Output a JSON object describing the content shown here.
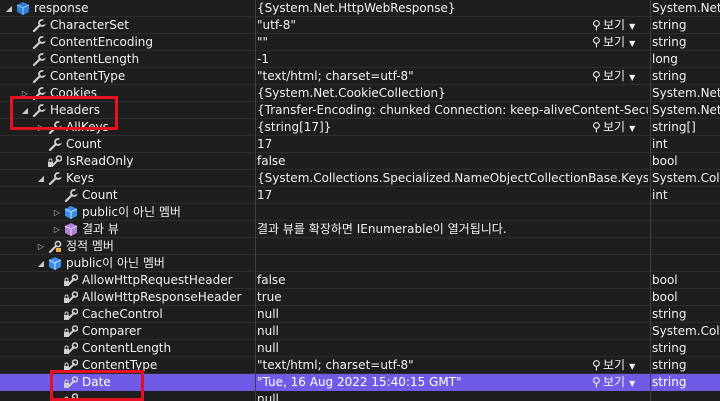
{
  "rows": [
    {
      "expander": "open",
      "icon": "object-icon",
      "name": "response",
      "value": "{System.Net.HttpWebResponse}",
      "type": "System.Net.W",
      "level": 0,
      "viz": false
    },
    {
      "expander": "",
      "icon": "wrench-icon",
      "name": "CharacterSet",
      "value": "\"utf-8\"",
      "type": "string",
      "level": 1,
      "viz": true
    },
    {
      "expander": "",
      "icon": "wrench-icon",
      "name": "ContentEncoding",
      "value": "\"\"",
      "type": "string",
      "level": 1,
      "viz": true
    },
    {
      "expander": "",
      "icon": "wrench-icon",
      "name": "ContentLength",
      "value": "-1",
      "type": "long",
      "level": 1,
      "viz": false
    },
    {
      "expander": "",
      "icon": "wrench-icon",
      "name": "ContentType",
      "value": "\"text/html; charset=utf-8\"",
      "type": "string",
      "level": 1,
      "viz": true
    },
    {
      "expander": "closed",
      "icon": "wrench-icon",
      "name": "Cookies",
      "value": "{System.Net.CookieCollection}",
      "type": "System.Net.C",
      "level": 1,
      "viz": false
    },
    {
      "expander": "open",
      "icon": "wrench-icon",
      "name": "Headers",
      "value": "{Transfer-Encoding: chunked Connection: keep-aliveContent-Security-P...",
      "type": "System.Net.W",
      "level": 1,
      "viz": false
    },
    {
      "expander": "closed",
      "icon": "wrench-icon",
      "name": "AllKeys",
      "value": "{string[17]}",
      "type": "string[]",
      "level": 2,
      "viz": true
    },
    {
      "expander": "",
      "icon": "wrench-icon",
      "name": "Count",
      "value": "17",
      "type": "int",
      "level": 2,
      "viz": false
    },
    {
      "expander": "",
      "icon": "wrench-lock-icon",
      "name": "IsReadOnly",
      "value": "false",
      "type": "bool",
      "level": 2,
      "viz": false
    },
    {
      "expander": "open",
      "icon": "wrench-icon",
      "name": "Keys",
      "value": "{System.Collections.Specialized.NameObjectCollectionBase.KeysCollect...",
      "type": "System.Colle",
      "level": 2,
      "viz": false
    },
    {
      "expander": "",
      "icon": "wrench-icon",
      "name": "Count",
      "value": "17",
      "type": "int",
      "level": 3,
      "viz": false
    },
    {
      "expander": "closed",
      "icon": "cube-blue-icon",
      "name": "public이 아닌 멤버",
      "value": "",
      "type": "",
      "level": 3,
      "viz": false
    },
    {
      "expander": "closed",
      "icon": "cube-purple-icon",
      "name": "결과 뷰",
      "value": "결과 뷰를 확장하면 IEnumerable이 열거됩니다.",
      "type": "",
      "level": 3,
      "viz": false
    },
    {
      "expander": "closed",
      "icon": "static-members-icon",
      "name": "정적 멤버",
      "value": "",
      "type": "",
      "level": 2,
      "viz": false
    },
    {
      "expander": "open",
      "icon": "cube-blue-icon",
      "name": "public이 아닌 멤버",
      "value": "",
      "type": "",
      "level": 2,
      "viz": false
    },
    {
      "expander": "",
      "icon": "wrench-lock-icon",
      "name": "AllowHttpRequestHeader",
      "value": "false",
      "type": "bool",
      "level": 3,
      "viz": false
    },
    {
      "expander": "",
      "icon": "wrench-lock-icon",
      "name": "AllowHttpResponseHeader",
      "value": "true",
      "type": "bool",
      "level": 3,
      "viz": false
    },
    {
      "expander": "",
      "icon": "wrench-lock-icon",
      "name": "CacheControl",
      "value": "null",
      "type": "string",
      "level": 3,
      "viz": false
    },
    {
      "expander": "",
      "icon": "wrench-lock-icon",
      "name": "Comparer",
      "value": "null",
      "type": "System.Colle",
      "level": 3,
      "viz": false
    },
    {
      "expander": "",
      "icon": "wrench-lock-icon",
      "name": "ContentLength",
      "value": "null",
      "type": "string",
      "level": 3,
      "viz": false
    },
    {
      "expander": "",
      "icon": "wrench-lock-icon",
      "name": "ContentType",
      "value": "\"text/html; charset=utf-8\"",
      "type": "string",
      "level": 3,
      "viz": true
    },
    {
      "expander": "",
      "icon": "wrench-lock-icon",
      "name": "Date",
      "value": "\"Tue, 16 Aug 2022 15:40:15 GMT\"",
      "type": "string",
      "level": 3,
      "viz": true,
      "selected": true
    },
    {
      "expander": "",
      "icon": "wrench-lock-icon",
      "name": "",
      "value": "null",
      "type": "",
      "level": 3,
      "viz": false
    }
  ],
  "visualizer_label": "보기",
  "colors": {
    "selection": "#6e5ce6",
    "highlight_box": "#e81123",
    "background": "#1e1e1e"
  }
}
